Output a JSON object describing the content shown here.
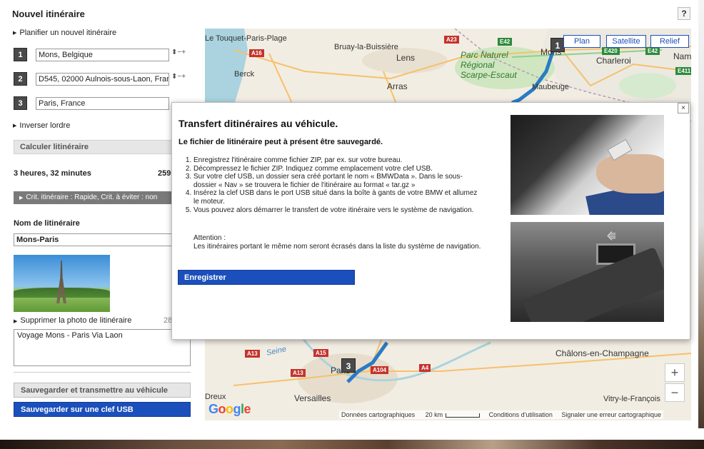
{
  "header": {
    "title": "Nouvel itinéraire",
    "help_label": "?"
  },
  "planner": {
    "plan_link": "Planifier un nouvel itinéraire",
    "waypoints": [
      {
        "num": "1",
        "value": "Mons, Belgique"
      },
      {
        "num": "2",
        "value": "D545, 02000 Aulnois-sous-Laon, France"
      },
      {
        "num": "3",
        "value": "Paris, France"
      }
    ],
    "waypoint_controls": "⬍−+",
    "reverse_link": "Inverser lordre",
    "calculate_label": "Calculer litinéraire",
    "duration": "3 heures, 32 minutes",
    "distance": "259",
    "criteria": "Crit. itinéraire : Rapide, Crit. à éviter : non"
  },
  "route": {
    "name_label": "Nom de litinéraire",
    "name_value": "Mons-Paris",
    "remove_photo_link": "Supprimer la photo de litinéraire",
    "photo_count": "28",
    "description": "Voyage Mons - Paris Via Laon",
    "save_vehicle_label": "Sauvegarder et transmettre au véhicule",
    "save_usb_label": "Sauvegarder sur une clef USB"
  },
  "map": {
    "view_buttons": [
      "Plan",
      "Satellite",
      "Relief"
    ],
    "places": {
      "touquet": "Le Touquet-Paris-Plage",
      "bruay": "Bruay-la-Buissière",
      "lens": "Lens",
      "berck": "Berck",
      "arras": "Arras",
      "mons": "Mons",
      "charleroi": "Charleroi",
      "namur": "Nam",
      "maubeuge": "Maubeuge",
      "chalons": "Châlons-en-Champagne",
      "paris": "Paris",
      "versailles": "Versailles",
      "dreux": "Dreux",
      "vitry": "Vitry-le-François",
      "seine": "Seine"
    },
    "park_label": [
      "Parc Naturel",
      "Régional",
      "Scarpe-Escaut"
    ],
    "roads": [
      "A16",
      "A23",
      "E42",
      "E420",
      "E42",
      "E411",
      "A13",
      "A15",
      "A13",
      "A104",
      "A4"
    ],
    "markers": [
      "1",
      "3"
    ],
    "zoom_in": "+",
    "zoom_out": "−",
    "footer": {
      "data": "Données cartographiques",
      "scale": "20 km",
      "terms": "Conditions d'utilisation",
      "report": "Signaler une erreur cartographique"
    },
    "google": [
      "G",
      "o",
      "o",
      "g",
      "l",
      "e"
    ]
  },
  "modal": {
    "close_label": "×",
    "title": "Transfert ditinéraires au véhicule.",
    "subtitle": "Le fichier de litinéraire peut à présent être sauvegardé.",
    "steps": [
      "Enregistrez l'itinéraire comme fichier ZIP, par ex. sur votre bureau.",
      "Décompressez le fichier ZIP. Indiquez comme emplacement votre clef USB.",
      "Sur votre clef USB, un dossier sera créé portant le nom « BMWData ». Dans le sous-dossier « Nav » se trouvera le fichier de l'itinéraire au format « tar.gz »",
      "Insérez la clef USB dans le port USB situé dans la boîte à gants de votre BMW et allumez le moteur.",
      "Vous pouvez alors démarrer le transfert de votre itinéraire vers le système de navigation."
    ],
    "warning_title": "Attention :",
    "warning_text": "Les itinéraires portant le même nom seront écrasés dans la liste du système de navigation.",
    "save_label": "Enregistrer"
  },
  "colors": {
    "accent": "#1b4fbb",
    "route": "#2a7bc4",
    "marker": "#4a4a4a"
  }
}
